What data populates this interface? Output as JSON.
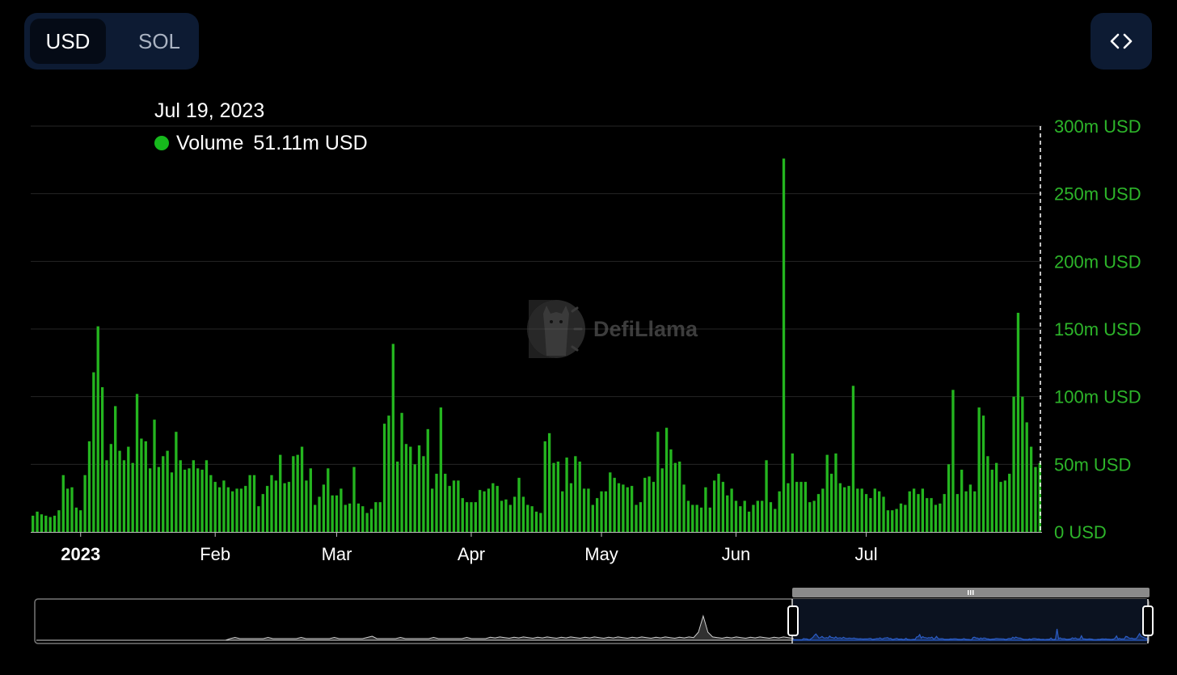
{
  "toolbar": {
    "currency_options": [
      "USD",
      "SOL"
    ],
    "selected": "USD",
    "embed_icon": "code-brackets-icon"
  },
  "watermark": {
    "text": "DefiLlama",
    "icon": "llama-logo"
  },
  "tooltip": {
    "date": "Jul 19, 2023",
    "series_label": "Volume",
    "value": "51.11m USD",
    "dot_color": "#16b91c"
  },
  "colors": {
    "bar": "#24b51f",
    "axis_label": "#2db52a",
    "brush_selected": "#2b5cc4"
  },
  "chart_data": {
    "type": "bar",
    "title": "",
    "xlabel": "",
    "ylabel": "",
    "ylim": [
      0,
      300
    ],
    "y_unit": "m USD",
    "y_ticks": [
      "0 USD",
      "50m USD",
      "100m USD",
      "150m USD",
      "200m USD",
      "250m USD",
      "300m USD"
    ],
    "x_ticks": [
      {
        "label": "2023",
        "date": "2023-01-01",
        "bold": true
      },
      {
        "label": "Feb",
        "date": "2023-02-01"
      },
      {
        "label": "Mar",
        "date": "2023-03-01"
      },
      {
        "label": "Apr",
        "date": "2023-04-01"
      },
      {
        "label": "May",
        "date": "2023-05-01"
      },
      {
        "label": "Jun",
        "date": "2023-06-01"
      },
      {
        "label": "Jul",
        "date": "2023-07-01"
      }
    ],
    "x_start": "2022-12-21",
    "x_end": "2023-07-19",
    "grid": true,
    "legend": "tooltip top-left",
    "series": [
      {
        "name": "Volume",
        "values": [
          12,
          15,
          13,
          12,
          11,
          12,
          16,
          42,
          32,
          33,
          18,
          16,
          42,
          67,
          118,
          152,
          107,
          53,
          65,
          93,
          60,
          53,
          63,
          51,
          102,
          69,
          67,
          47,
          83,
          48,
          56,
          60,
          44,
          74,
          53,
          46,
          47,
          53,
          47,
          46,
          53,
          42,
          37,
          33,
          38,
          33,
          30,
          32,
          32,
          34,
          42,
          42,
          19,
          28,
          34,
          42,
          38,
          57,
          36,
          37,
          56,
          57,
          63,
          38,
          47,
          20,
          26,
          35,
          47,
          27,
          27,
          32,
          20,
          21,
          48,
          21,
          19,
          14,
          17,
          22,
          22,
          80,
          86,
          139,
          52,
          88,
          65,
          63,
          50,
          64,
          56,
          76,
          32,
          43,
          92,
          43,
          34,
          38,
          38,
          25,
          22,
          22,
          22,
          31,
          30,
          32,
          36,
          34,
          23,
          24,
          20,
          26,
          40,
          26,
          20,
          19,
          15,
          14,
          67,
          73,
          51,
          52,
          30,
          55,
          36,
          56,
          52,
          32,
          32,
          20,
          25,
          30,
          30,
          44,
          40,
          36,
          35,
          33,
          34,
          20,
          22,
          40,
          41,
          37,
          74,
          47,
          77,
          61,
          51,
          52,
          35,
          23,
          20,
          20,
          18,
          33,
          18,
          38,
          43,
          37,
          27,
          32,
          23,
          19,
          23,
          15,
          20,
          23,
          23,
          53,
          22,
          17,
          30,
          276,
          36,
          58,
          37,
          37,
          37,
          22,
          23,
          28,
          32,
          57,
          43,
          58,
          36,
          33,
          34,
          108,
          32,
          32,
          28,
          25,
          32,
          30,
          26,
          16,
          16,
          17,
          21,
          20,
          30,
          32,
          28,
          32,
          25,
          25,
          20,
          21,
          28,
          50,
          105,
          28,
          46,
          30,
          35,
          30,
          92,
          86,
          56,
          46,
          51,
          37,
          38,
          43,
          100,
          162,
          100,
          81,
          63,
          48,
          51
        ]
      }
    ]
  }
}
